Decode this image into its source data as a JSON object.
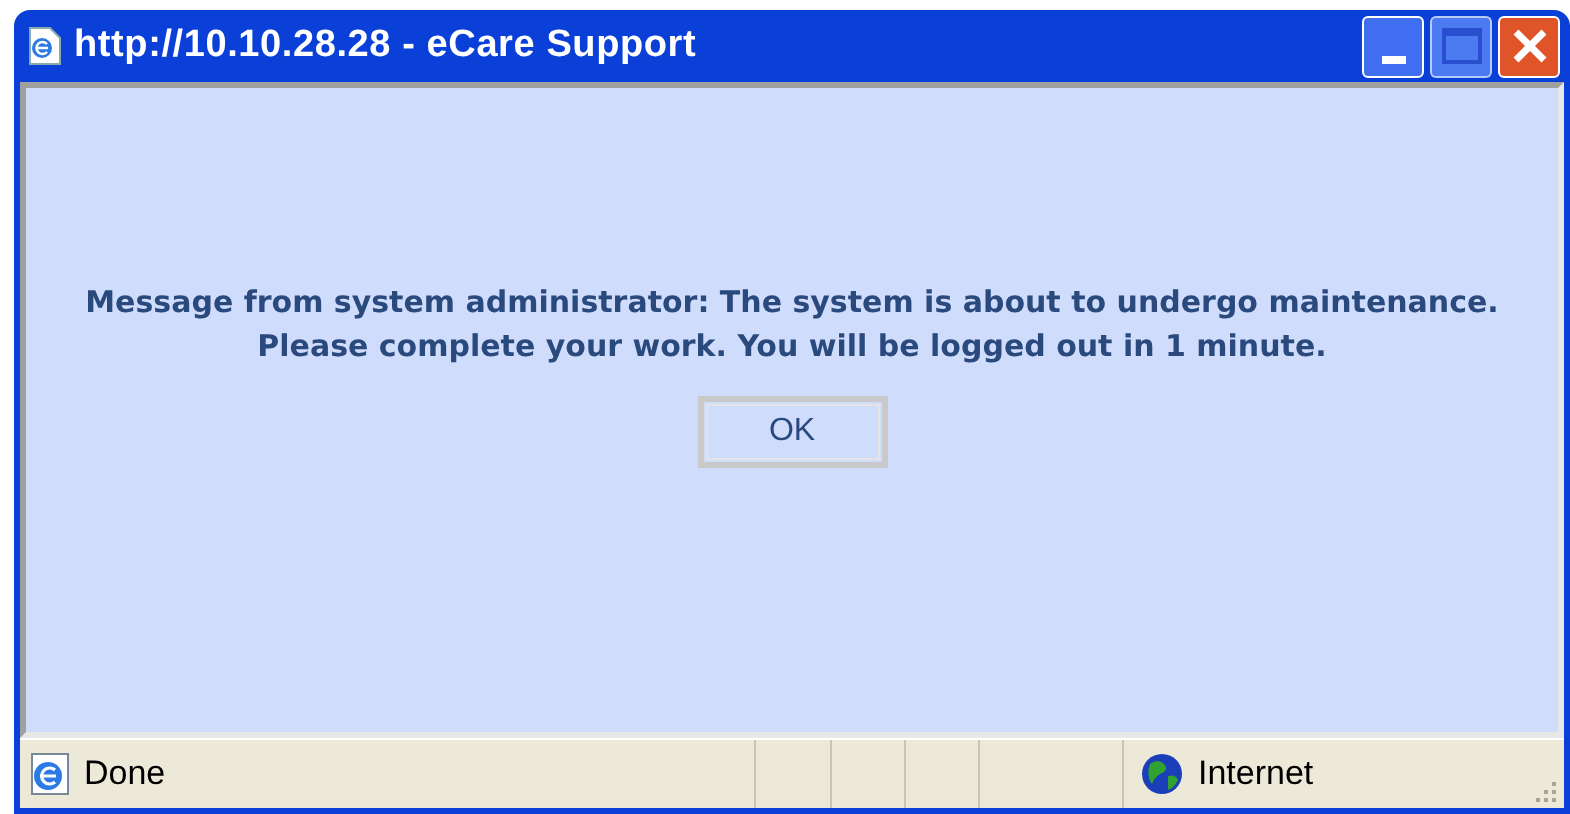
{
  "window": {
    "title": "http://10.10.28.28 - eCare Support"
  },
  "message": {
    "text": "Message from system administrator: The system is about to undergo maintenance. Please complete your work. You will be logged out in 1 minute.",
    "button": "OK"
  },
  "status_bar": {
    "status": "Done",
    "zone": "Internet"
  }
}
